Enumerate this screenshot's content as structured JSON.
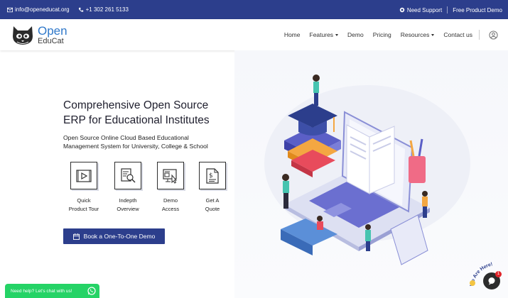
{
  "topbar": {
    "email": "info@openeducat.org",
    "phone": "+1 302 261 5133",
    "support": "Need Support",
    "demo": "Free Product Demo"
  },
  "nav": {
    "logo_line1": "Open",
    "logo_line2": "EduCat",
    "items": [
      "Home",
      "Features",
      "Demo",
      "Pricing",
      "Resources",
      "Contact us"
    ]
  },
  "hero": {
    "title_line1": "Comprehensive Open Source",
    "title_line2": "ERP for Educational Institutes",
    "subtitle_line1": "Open Source Online Cloud Based Educational",
    "subtitle_line2": "Management System for University, College & School",
    "features": [
      {
        "line1": "Quick",
        "line2": "Product Tour",
        "icon": "video-icon"
      },
      {
        "line1": "Indepth",
        "line2": "Overview",
        "icon": "document-search-icon"
      },
      {
        "line1": "Demo",
        "line2": "Access",
        "icon": "monitor-cursor-icon"
      },
      {
        "line1": "Get A",
        "line2": "Quote",
        "icon": "dollar-document-icon"
      }
    ],
    "cta": "Book a One-To-One Demo"
  },
  "chat": {
    "text": "Need help? Let's chat with us!",
    "widget_text": "We Are Here!",
    "badge": "1"
  },
  "colors": {
    "primary": "#2c3e8c",
    "whatsapp": "#25d366",
    "logo_blue": "#2f78c9"
  }
}
